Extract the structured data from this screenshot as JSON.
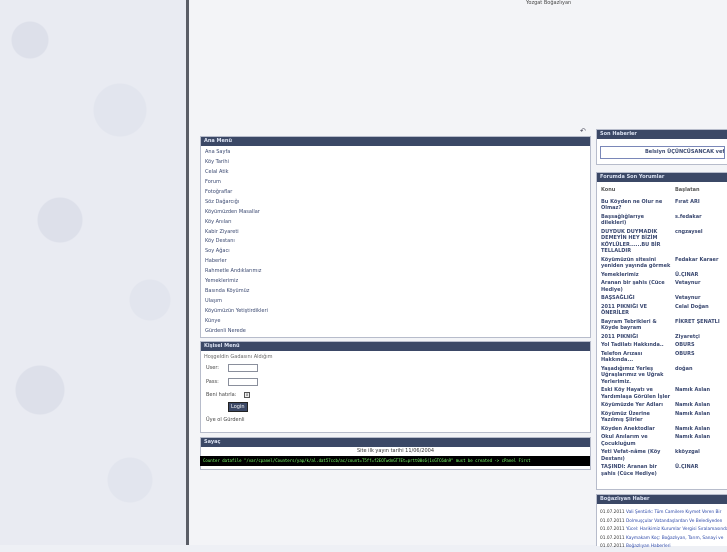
{
  "site": {
    "title": "Yozgat Boğazlıyan"
  },
  "main_menu": {
    "title": "Ana Menü",
    "items": [
      "Ana Sayfa",
      "Köy Tarihi",
      "Celal Atik",
      "Forum",
      "Fotoğraflar",
      "Söz Dağarcığı",
      "Köyümüzden Masallar",
      "Köy Anıları",
      "Kabir Ziyareti",
      "Köy Destanı",
      "Soy Ağacı",
      "Haberler",
      "Rahmetle Andıklarımız",
      "Yemeklerimiz",
      "Basında Köyümüz",
      "Ulaşım",
      "Köyümüzün Yetiştirdikleri",
      "Künye",
      "Gürdenli Nerede"
    ]
  },
  "user_menu": {
    "title": "Kişisel Menü",
    "welcome": "Hoşgeldin Gadasını Aldığım",
    "user_label": "User:",
    "pass_label": "Pass:",
    "remember_label": "Beni hatırla:",
    "remember_checked": "x",
    "login_button": "Login",
    "register_link": "Üye ol Gürdenli"
  },
  "counter": {
    "title": "Sayaç",
    "since": "Site ilk yayın tarihi 11/06/2004",
    "error": "Counter datafile \"/var/cpanel/Counters/yap/k/al.dat57ccb/ac/count=T5ff=f2EOTwdnGT7Et=prtt00s6(1sGTC6dn9\" must be created -> cPanel First"
  },
  "latest_news": {
    "title": "Son Haberler",
    "ticker": "Belsiyn ÜÇÜNCÜSANCAK vefat"
  },
  "forum_latest": {
    "title": "Forumda Son Yorumlar",
    "col_topic": "Konu",
    "col_author": "Başlatan",
    "rows": [
      {
        "topic": "Bu Köyden ne Olur ne Olmaz?",
        "author": "Fırat ARI"
      },
      {
        "topic": "Başsağlığlarıye dilekleri)",
        "author": "s.fedakar"
      },
      {
        "topic": "DUYDUK DUYMADIK DEMEYİN HEY BİZİM KÖYLÜLER......BU BİR TELLALDIR",
        "author": "cngzaysel"
      },
      {
        "topic": "Köyümüzün sitesini yeniden yayında görmek",
        "author": "Fedakar Karaer"
      },
      {
        "topic": "Yemeklerimiz",
        "author": "Ü.ÇINAR"
      },
      {
        "topic": "Aranan bir şahis (Cüce Hediye)",
        "author": "Vetaynur"
      },
      {
        "topic": "BAŞSAĞLIĞI",
        "author": "Vetaynur"
      },
      {
        "topic": "2011 PIKNIĞI VE ÖNERİLER",
        "author": "Celal Doğan"
      },
      {
        "topic": "Bayram Tebrikleri & Köyde bayram",
        "author": "FİKRET ŞENATLI"
      },
      {
        "topic": "2011 PIKNIĞI",
        "author": "Ziyaretçi"
      },
      {
        "topic": "Yol Tadilatı Hakkında..",
        "author": "OBURS"
      },
      {
        "topic": "Telefon Arızası Hakkında...",
        "author": "OBURS"
      },
      {
        "topic": "Yaşadığımız Yerleş Uğraşlarımız ve Uğrak Yerlerimiz.",
        "author": "doğan"
      },
      {
        "topic": "Eski Köy Hayatı ve Yardımlaşa Görülen İşler",
        "author": "Namık Aslan"
      },
      {
        "topic": "Köyümüzde Yer Adları",
        "author": "Namık Aslan"
      },
      {
        "topic": "Köyümüz Üzerine Yazılmış Şiirler",
        "author": "Namık Aslan"
      },
      {
        "topic": "Köyden Anektodlar",
        "author": "Namık Aslan"
      },
      {
        "topic": "Okul Anılarım ve Çocukluğum",
        "author": "Namık Aslan"
      },
      {
        "topic": "Yeti Vefat-nâme (Köy Destanı)",
        "author": "kköyzgal"
      },
      {
        "topic": "TAŞINDI: Aranan bir şahis (Cüce Hediye)",
        "author": "Ü.ÇINAR"
      }
    ]
  },
  "bogazliyan_news": {
    "title": "Boğazlıyan Haber",
    "rows": [
      {
        "date": "01.07.2011",
        "text": "Vali Şentürk: Tüm Camilere Kıymet Veren Bir"
      },
      {
        "date": "01.07.2011",
        "text": "Dolmuşçular Vatandaşlardan Ve Belediyeden"
      },
      {
        "date": "01.07.2011",
        "text": "Yücel: Harikimiz Kurumlar Vergisi Sıralamasında"
      },
      {
        "date": "01.07.2011",
        "text": "Kaymakam Koç: Boğazlıyan, Tarım, Sanayi ve"
      },
      {
        "date": "01.07.2011",
        "text": "Boğazlıyan Haberleri"
      }
    ]
  }
}
